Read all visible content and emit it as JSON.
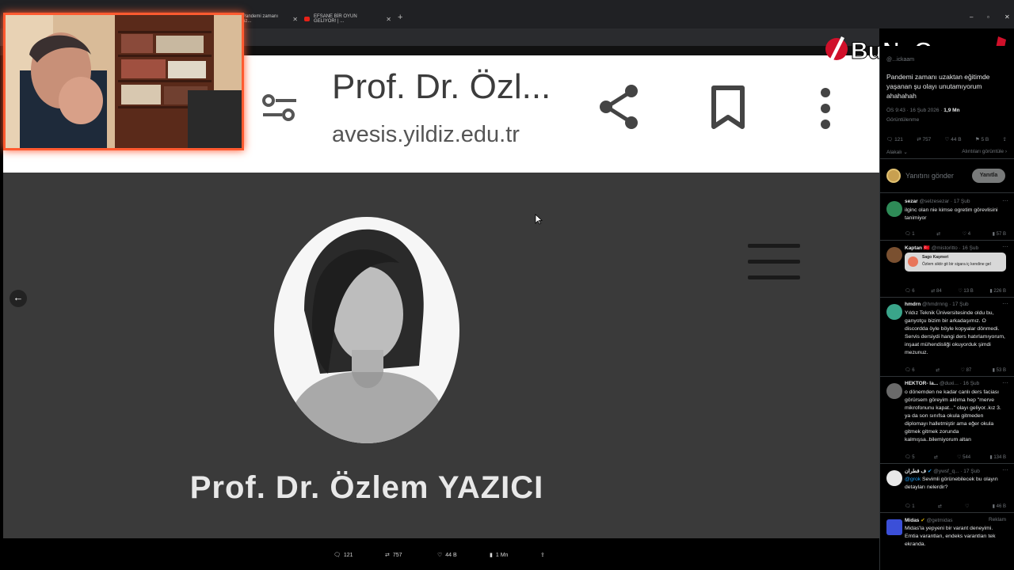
{
  "browser": {
    "tabs": [
      {
        "label": "Pandemi zamanı uz..."
      },
      {
        "label": "EFSANE BİR OYUN GELİYOR! | ..."
      }
    ],
    "new_tab": "+",
    "window_controls": [
      "–",
      "▫",
      "✕"
    ]
  },
  "lightbox": {
    "header_title": "Prof. Dr. Özl...",
    "header_domain": "avesis.yildiz.edu.tr",
    "profile_name": "Prof. Dr. Özlem YAZICI"
  },
  "logo": {
    "text": "BuNoGame"
  },
  "action_bar": {
    "replies": "121",
    "reposts": "757",
    "likes": "44 B",
    "views": "1 Mn"
  },
  "tweet": {
    "author_handle": "@...ickaam",
    "text": "Pandemi zamanı uzaktan eğitimde yaşanan şu olayı unutamıyorum ahahahah",
    "time": "ÖS 9:43 · 16 Şub 2026 · ",
    "views_count": "1,9 Mn",
    "views_label": "Görüntülenme",
    "stats": {
      "replies": "121",
      "reposts": "757",
      "likes": "44 B",
      "bookmarks": "5 B"
    },
    "sort_left": "Alakalı ⌄",
    "sort_right": "Alıntıları görüntüle ›"
  },
  "reply_box": {
    "placeholder": "Yanıtını gönder",
    "button": "Yanıtla"
  },
  "comments": [
    {
      "name": "sezar",
      "handle": "@selzesezar · 17 Şub",
      "text": "ilginc olan nie kimse ogretim görevlisini tanimiyor",
      "replies": "1",
      "reposts": "",
      "likes": "4",
      "views": "57 B"
    },
    {
      "name": "Kaptan 🇹🇷",
      "handle": "@mistoritto · 16 Şub",
      "text": "",
      "quote_name": "Sago Kaşmeri",
      "quote_text": "Özlem siktir git bir sigara iç kendine gel",
      "replies": "6",
      "reposts": "84",
      "likes": "13 B",
      "views": "226 B"
    },
    {
      "name": "hmdrn",
      "handle": "@hmdrnng · 17 Şub",
      "text": "Yıldız Teknik Üniversitesinde oldu bu, ganyotçu bizim bir arkadaşımız. O discordda öyle böyle kopyalar dönmedi. Servis dersiydi hangi ders hatırlamıyorum, inşaat mühendisliği okuyorduk şimdi mezunuz.",
      "replies": "6",
      "reposts": "",
      "likes": "87",
      "views": "53 B"
    },
    {
      "name": "HEKTOR- la...",
      "handle": "@duxi... · 16 Şub",
      "text": "o dönemden ne kadar canlı ders faciası görürsem göreyim aklıma hep \"merve mikrofonunu kapat...\" olayı geliyor..kız 3. ya da son sınıfsa okula gitmeden diplomayı halletmiştir ama eğer okula gitmek gitmek zorunda kalmışsa..bilemiyorum altan",
      "replies": "5",
      "reposts": "",
      "likes": "544",
      "views": "134 B"
    },
    {
      "name": "ف قطران",
      "handle": "@ywsf_q... · 17 Şub",
      "mention": "@grok",
      "text": "Sevimli görünebilecek bu olayın detayları nelerdir?",
      "replies": "1",
      "reposts": "",
      "likes": "",
      "views": "46 B"
    },
    {
      "name": "Midas",
      "handle": "@getmidas",
      "ad_label": "Reklam",
      "text": "Midas'la yepyeni bir varant deneyimi. Emtia varantları, endeks varantları tek ekranda."
    }
  ],
  "colors": {
    "accent": "#ff5a30",
    "link": "#1d9bf0",
    "panel_bg": "#000000",
    "lightbox_bg": "#3a3a3a"
  }
}
